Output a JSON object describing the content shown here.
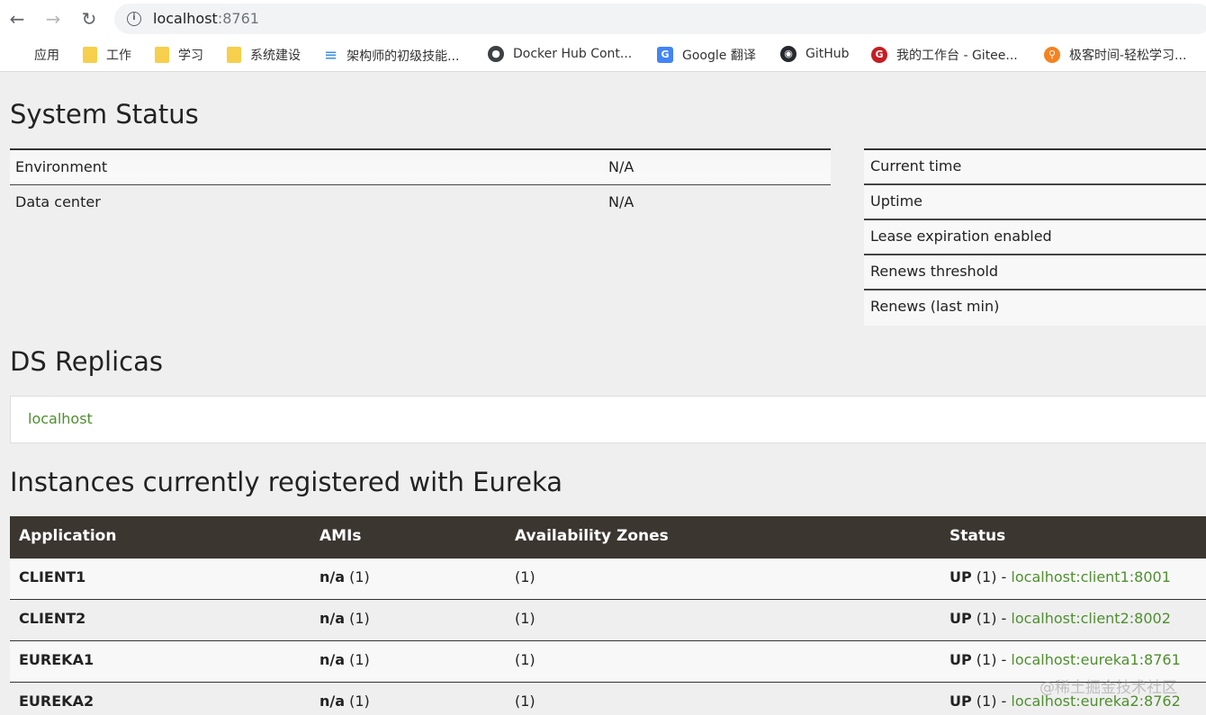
{
  "browser": {
    "url_host": "localhost",
    "url_port": ":8761",
    "bookmarks": [
      {
        "label": "应用",
        "icon": "apps-grid-icon"
      },
      {
        "label": "工作",
        "icon": "folder-icon"
      },
      {
        "label": "学习",
        "icon": "folder-icon"
      },
      {
        "label": "系统建设",
        "icon": "folder-icon"
      },
      {
        "label": "架构师的初级技能...",
        "icon": "layers-icon"
      },
      {
        "label": "Docker Hub Cont...",
        "icon": "docker-icon"
      },
      {
        "label": "Google 翻译",
        "icon": "google-translate-icon"
      },
      {
        "label": "GitHub",
        "icon": "github-icon"
      },
      {
        "label": "我的工作台 - Gitee...",
        "icon": "gitee-icon"
      },
      {
        "label": "极客时间-轻松学习...",
        "icon": "geektime-icon"
      }
    ]
  },
  "system_status": {
    "title": "System Status",
    "left_rows": [
      {
        "key": "Environment",
        "value": "N/A"
      },
      {
        "key": "Data center",
        "value": "N/A"
      }
    ],
    "right_rows": [
      {
        "key": "Current time"
      },
      {
        "key": "Uptime"
      },
      {
        "key": "Lease expiration enabled"
      },
      {
        "key": "Renews threshold"
      },
      {
        "key": "Renews (last min)"
      }
    ]
  },
  "ds_replicas": {
    "title": "DS Replicas",
    "items": [
      "localhost"
    ]
  },
  "instances": {
    "title": "Instances currently registered with Eureka",
    "headers": [
      "Application",
      "AMIs",
      "Availability Zones",
      "Status"
    ],
    "rows": [
      {
        "app": "CLIENT1",
        "ami": "n/a",
        "ami_count": " (1)",
        "zones": "(1)",
        "status": "UP",
        "status_count": " (1) - ",
        "link": "localhost:client1:8001"
      },
      {
        "app": "CLIENT2",
        "ami": "n/a",
        "ami_count": " (1)",
        "zones": "(1)",
        "status": "UP",
        "status_count": " (1) - ",
        "link": "localhost:client2:8002"
      },
      {
        "app": "EUREKA1",
        "ami": "n/a",
        "ami_count": " (1)",
        "zones": "(1)",
        "status": "UP",
        "status_count": " (1) - ",
        "link": "localhost:eureka1:8761"
      },
      {
        "app": "EUREKA2",
        "ami": "n/a",
        "ami_count": " (1)",
        "zones": "(1)",
        "status": "UP",
        "status_count": " (1) - ",
        "link": "localhost:eureka2:8762"
      }
    ]
  },
  "watermark": "@稀土掘金技术社区",
  "colors": {
    "link_green": "#4f8f2f",
    "table_header": "#3b3630"
  }
}
